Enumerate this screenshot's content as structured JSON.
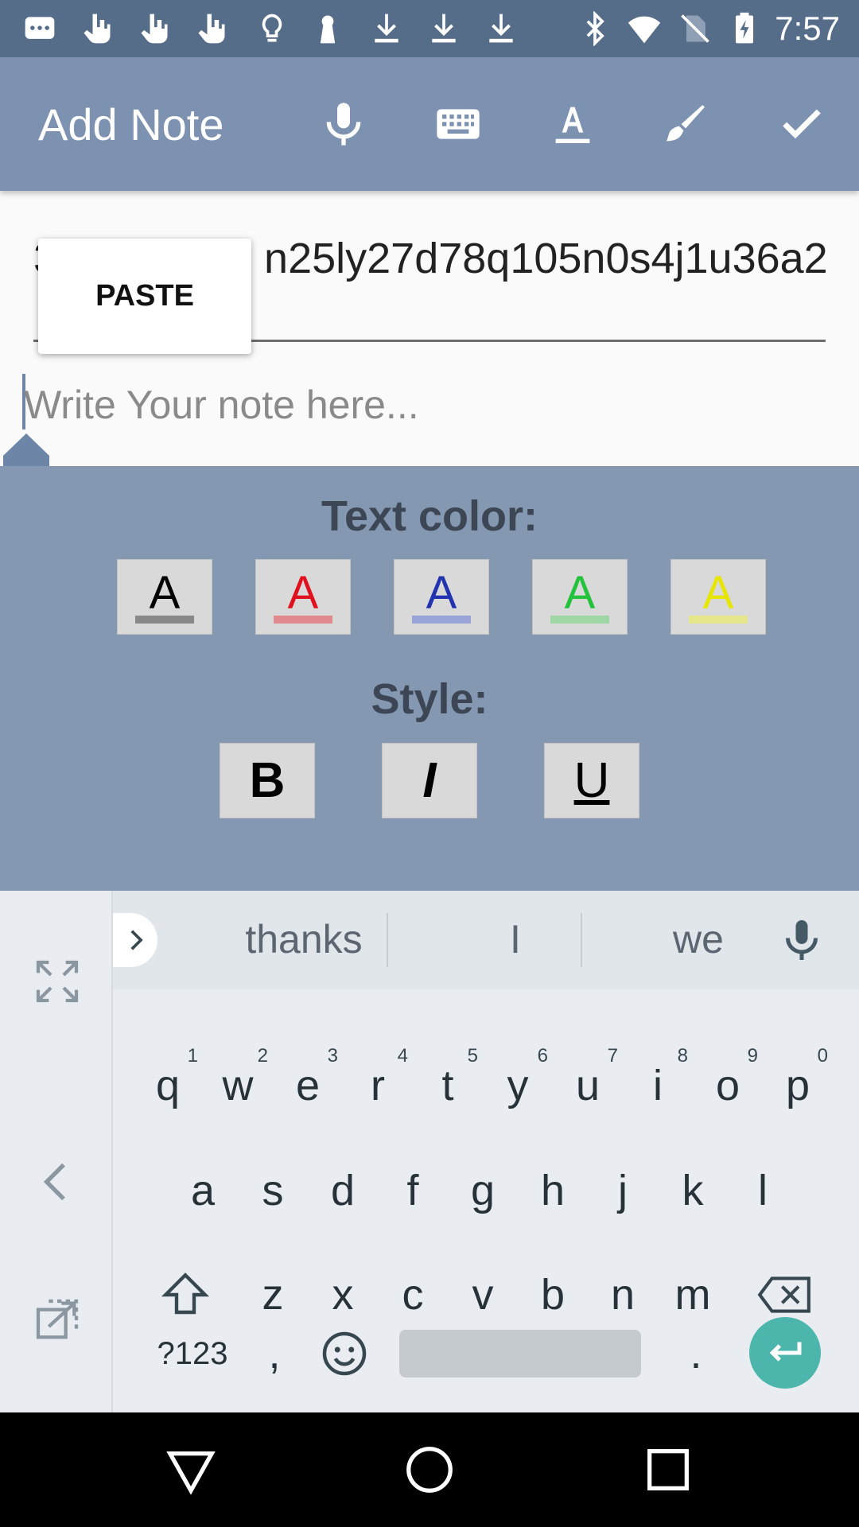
{
  "status_bar": {
    "time": "7:57",
    "icons": [
      "messages-icon",
      "touch-icon",
      "touch-icon",
      "touch-icon",
      "lightbulb-icon",
      "keyhole-icon",
      "download-icon",
      "download-icon",
      "download-icon",
      "bluetooth-icon",
      "wifi-icon",
      "no-sim-icon",
      "battery-charging-icon"
    ]
  },
  "app_bar": {
    "title": "Add Note",
    "actions": [
      "microphone-icon",
      "keyboard-icon",
      "text-color-icon",
      "brush-icon",
      "check-icon"
    ]
  },
  "title_field": {
    "value_visible": "3",
    "value_rest": "n25ly27d78q105n0s4j1u36a2"
  },
  "context_menu": {
    "paste_label": "PASTE"
  },
  "note_field": {
    "placeholder": "Write Your note here..."
  },
  "format_panel": {
    "text_color_heading": "Text color:",
    "color_options": [
      {
        "letter": "A",
        "color": "#000000",
        "bar": "#888888"
      },
      {
        "letter": "A",
        "color": "#e0101e",
        "bar": "#e08a8e"
      },
      {
        "letter": "A",
        "color": "#2233b0",
        "bar": "#9aa3d6"
      },
      {
        "letter": "A",
        "color": "#22c23a",
        "bar": "#9ed6a4"
      },
      {
        "letter": "A",
        "color": "#e6e600",
        "bar": "#e6e68a"
      }
    ],
    "style_heading": "Style:",
    "style_options": [
      "B",
      "I",
      "U"
    ]
  },
  "keyboard": {
    "suggestions": [
      "thanks",
      "I",
      "we"
    ],
    "row1": [
      "q",
      "w",
      "e",
      "r",
      "t",
      "y",
      "u",
      "i",
      "o",
      "p"
    ],
    "row1_hints": [
      "1",
      "2",
      "3",
      "4",
      "5",
      "6",
      "7",
      "8",
      "9",
      "0"
    ],
    "row2": [
      "a",
      "s",
      "d",
      "f",
      "g",
      "h",
      "j",
      "k",
      "l"
    ],
    "row3": [
      "z",
      "x",
      "c",
      "v",
      "b",
      "n",
      "m"
    ],
    "symbols_label": "?123",
    "comma": ",",
    "period": "."
  },
  "colors": {
    "status_bar": "#566d8a",
    "app_bar": "#7c92b0",
    "format_panel": "#8598b2",
    "enter_key": "#4db6ac"
  }
}
